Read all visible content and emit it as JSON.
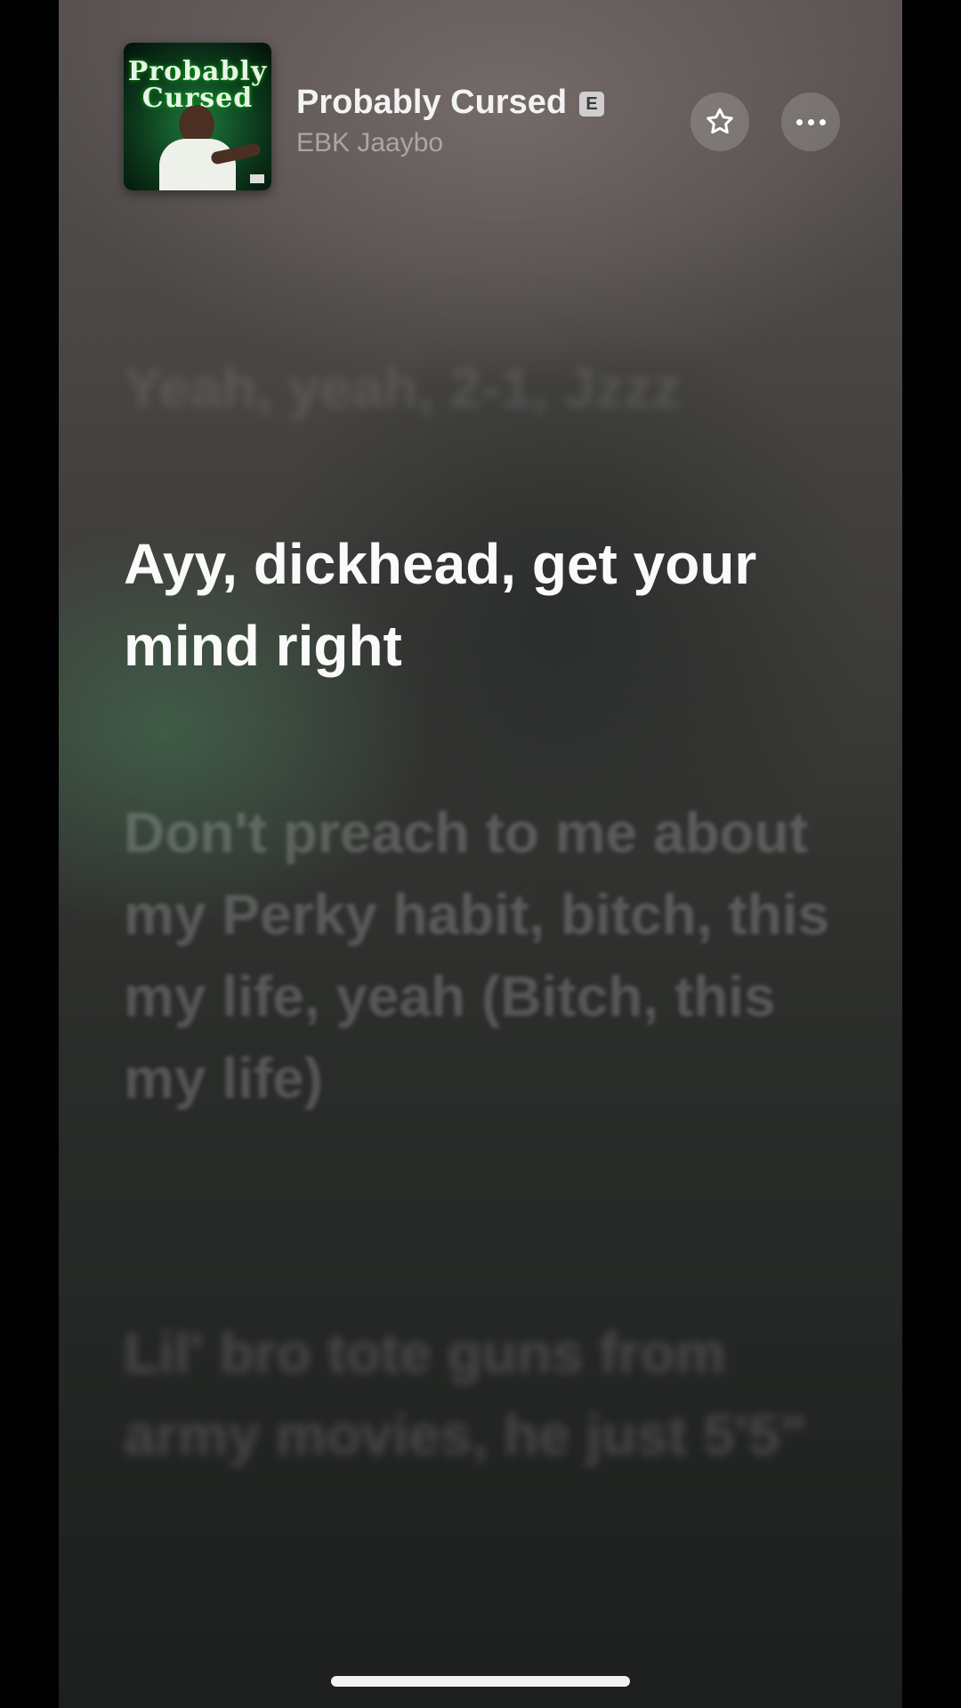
{
  "now_playing": {
    "artwork": {
      "title_text": "Probably Cursed",
      "icon": "album-artwork"
    },
    "title": "Probably Cursed",
    "explicit_badge": "E",
    "artist": "EBK Jaaybo"
  },
  "actions": {
    "favorite_icon": "star-icon",
    "more_icon": "ellipsis-icon"
  },
  "lyrics": {
    "previous_line": "Yeah, yeah, 2-1, Jzzz",
    "current_line": "Ayy, dickhead, get your mind right",
    "next_line_1": "Don't preach to me about my Perky habit, bitch, this my life, yeah (Bitch, this my life)",
    "next_line_2": "Lil' bro tote guns from army movies, he just 5'5\""
  },
  "colors": {
    "background_top": "#57514f",
    "background_bottom": "#1d1f1e",
    "active_lyric": "#fafafa",
    "inactive_lyric": "rgba(255,255,255,0.20)",
    "accent_green": "#1e7a3c"
  }
}
